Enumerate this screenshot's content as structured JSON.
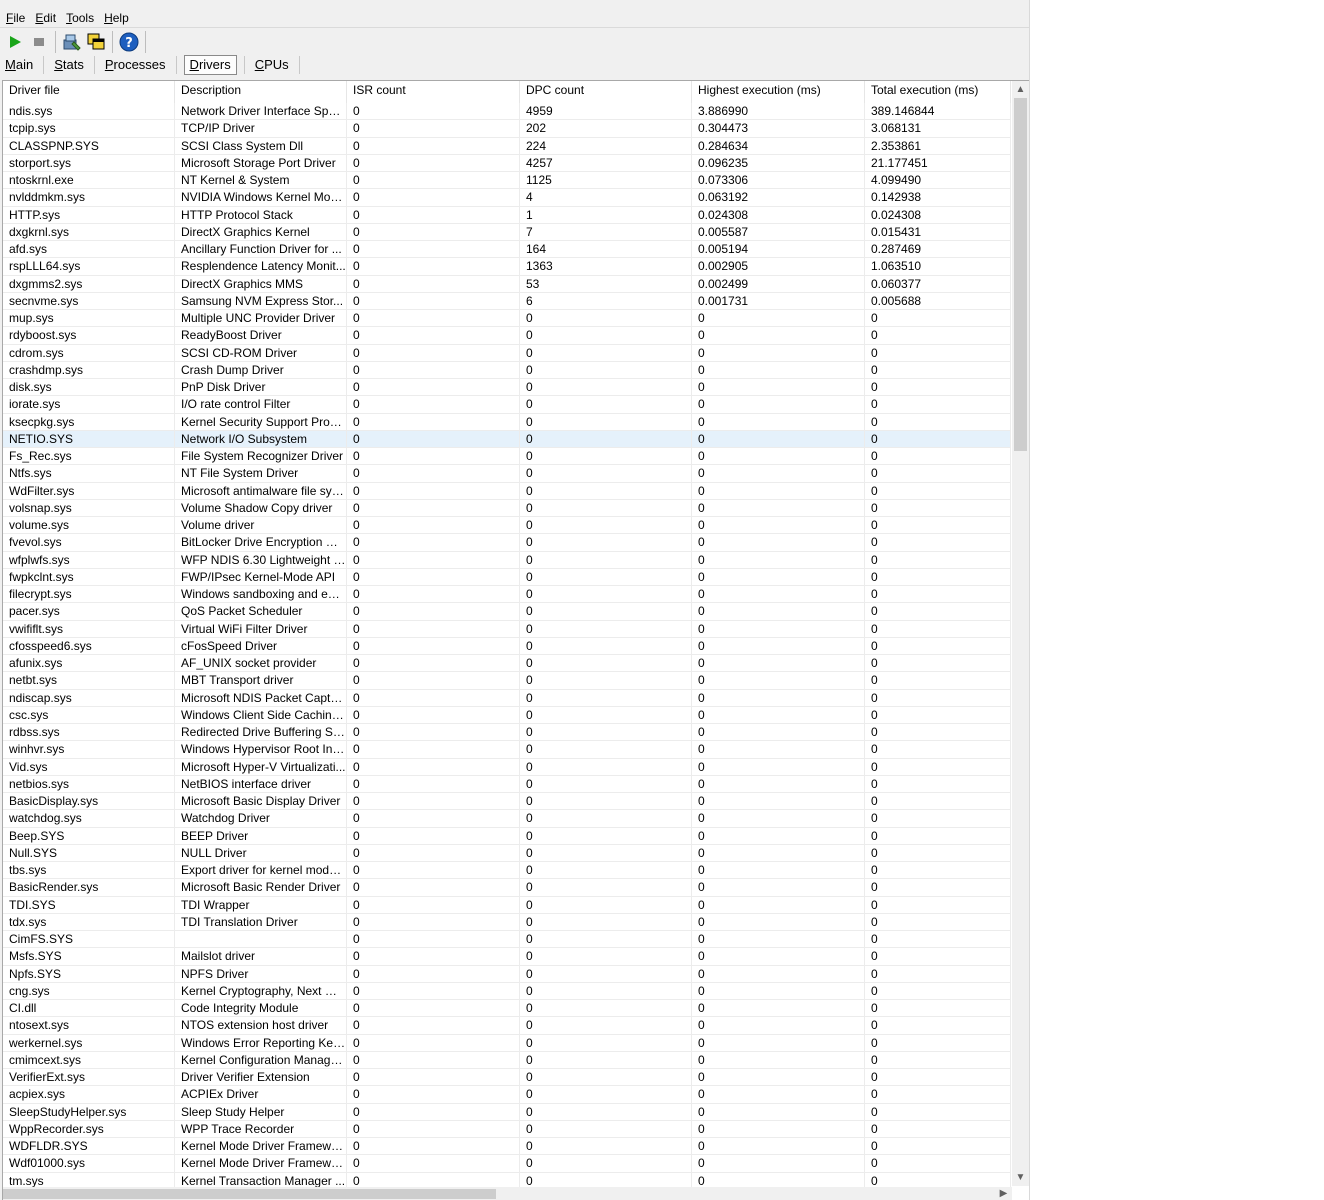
{
  "menu": [
    {
      "ul": "F",
      "rest": "ile"
    },
    {
      "ul": "E",
      "rest": "dit"
    },
    {
      "ul": "T",
      "rest": "ools"
    },
    {
      "ul": "H",
      "rest": "elp"
    }
  ],
  "toolbar": {
    "icons": [
      "play-icon",
      "stop-icon",
      "driver-icon",
      "copy-windows-icon",
      "help-icon"
    ],
    "colors": {
      "play": "#1aa51a",
      "stop": "#8c8c8c",
      "help": "#1e5fbf"
    }
  },
  "tabs": [
    {
      "ul": "M",
      "rest": "ain",
      "active": false
    },
    {
      "ul": "S",
      "rest": "tats",
      "active": false
    },
    {
      "ul": "P",
      "rest": "rocesses",
      "active": false
    },
    {
      "ul": "D",
      "rest": "rivers",
      "active": true
    },
    {
      "ul": "C",
      "rest": "PUs",
      "active": false
    }
  ],
  "table": {
    "columns": [
      "Driver file",
      "Description",
      "ISR count",
      "DPC count",
      "Highest execution (ms)",
      "Total execution (ms)"
    ],
    "selected_row": 19,
    "rows": [
      [
        "ndis.sys",
        "Network Driver Interface Speci...",
        "0",
        "4959",
        "3.886990",
        "389.146844"
      ],
      [
        "tcpip.sys",
        "TCP/IP Driver",
        "0",
        "202",
        "0.304473",
        "3.068131"
      ],
      [
        "CLASSPNP.SYS",
        "SCSI Class System Dll",
        "0",
        "224",
        "0.284634",
        "2.353861"
      ],
      [
        "storport.sys",
        "Microsoft Storage Port Driver",
        "0",
        "4257",
        "0.096235",
        "21.177451"
      ],
      [
        "ntoskrnl.exe",
        "NT Kernel & System",
        "0",
        "1125",
        "0.073306",
        "4.099490"
      ],
      [
        "nvlddmkm.sys",
        "NVIDIA Windows Kernel Mod...",
        "0",
        "4",
        "0.063192",
        "0.142938"
      ],
      [
        "HTTP.sys",
        "HTTP Protocol Stack",
        "0",
        "1",
        "0.024308",
        "0.024308"
      ],
      [
        "dxgkrnl.sys",
        "DirectX Graphics Kernel",
        "0",
        "7",
        "0.005587",
        "0.015431"
      ],
      [
        "afd.sys",
        "Ancillary Function Driver for ...",
        "0",
        "164",
        "0.005194",
        "0.287469"
      ],
      [
        "rspLLL64.sys",
        "Resplendence Latency Monit...",
        "0",
        "1363",
        "0.002905",
        "1.063510"
      ],
      [
        "dxgmms2.sys",
        "DirectX Graphics MMS",
        "0",
        "53",
        "0.002499",
        "0.060377"
      ],
      [
        "secnvme.sys",
        "Samsung NVM Express Stor...",
        "0",
        "6",
        "0.001731",
        "0.005688"
      ],
      [
        "mup.sys",
        "Multiple UNC Provider Driver",
        "0",
        "0",
        "0",
        "0"
      ],
      [
        "rdyboost.sys",
        "ReadyBoost Driver",
        "0",
        "0",
        "0",
        "0"
      ],
      [
        "cdrom.sys",
        "SCSI CD-ROM Driver",
        "0",
        "0",
        "0",
        "0"
      ],
      [
        "crashdmp.sys",
        "Crash Dump Driver",
        "0",
        "0",
        "0",
        "0"
      ],
      [
        "disk.sys",
        "PnP Disk Driver",
        "0",
        "0",
        "0",
        "0"
      ],
      [
        "iorate.sys",
        "I/O rate control Filter",
        "0",
        "0",
        "0",
        "0"
      ],
      [
        "ksecpkg.sys",
        "Kernel Security Support Provi...",
        "0",
        "0",
        "0",
        "0"
      ],
      [
        "NETIO.SYS",
        "Network I/O Subsystem",
        "0",
        "0",
        "0",
        "0"
      ],
      [
        "Fs_Rec.sys",
        "File System Recognizer Driver",
        "0",
        "0",
        "0",
        "0"
      ],
      [
        "Ntfs.sys",
        "NT File System Driver",
        "0",
        "0",
        "0",
        "0"
      ],
      [
        "WdFilter.sys",
        "Microsoft antimalware file sys...",
        "0",
        "0",
        "0",
        "0"
      ],
      [
        "volsnap.sys",
        "Volume Shadow Copy driver",
        "0",
        "0",
        "0",
        "0"
      ],
      [
        "volume.sys",
        "Volume driver",
        "0",
        "0",
        "0",
        "0"
      ],
      [
        "fvevol.sys",
        "BitLocker Drive Encryption Dri...",
        "0",
        "0",
        "0",
        "0"
      ],
      [
        "wfplwfs.sys",
        "WFP NDIS 6.30 Lightweight F...",
        "0",
        "0",
        "0",
        "0"
      ],
      [
        "fwpkclnt.sys",
        "FWP/IPsec Kernel-Mode API",
        "0",
        "0",
        "0",
        "0"
      ],
      [
        "filecrypt.sys",
        "Windows sandboxing and enc...",
        "0",
        "0",
        "0",
        "0"
      ],
      [
        "pacer.sys",
        "QoS Packet Scheduler",
        "0",
        "0",
        "0",
        "0"
      ],
      [
        "vwififlt.sys",
        "Virtual WiFi Filter Driver",
        "0",
        "0",
        "0",
        "0"
      ],
      [
        "cfosspeed6.sys",
        "cFosSpeed Driver",
        "0",
        "0",
        "0",
        "0"
      ],
      [
        "afunix.sys",
        "AF_UNIX socket provider",
        "0",
        "0",
        "0",
        "0"
      ],
      [
        "netbt.sys",
        "MBT Transport driver",
        "0",
        "0",
        "0",
        "0"
      ],
      [
        "ndiscap.sys",
        "Microsoft NDIS Packet Captur...",
        "0",
        "0",
        "0",
        "0"
      ],
      [
        "csc.sys",
        "Windows Client Side Caching...",
        "0",
        "0",
        "0",
        "0"
      ],
      [
        "rdbss.sys",
        "Redirected Drive Buffering Su...",
        "0",
        "0",
        "0",
        "0"
      ],
      [
        "winhvr.sys",
        "Windows Hypervisor Root Inte...",
        "0",
        "0",
        "0",
        "0"
      ],
      [
        "Vid.sys",
        "Microsoft Hyper-V Virtualizati...",
        "0",
        "0",
        "0",
        "0"
      ],
      [
        "netbios.sys",
        "NetBIOS interface driver",
        "0",
        "0",
        "0",
        "0"
      ],
      [
        "BasicDisplay.sys",
        "Microsoft Basic Display Driver",
        "0",
        "0",
        "0",
        "0"
      ],
      [
        "watchdog.sys",
        "Watchdog Driver",
        "0",
        "0",
        "0",
        "0"
      ],
      [
        "Beep.SYS",
        "BEEP Driver",
        "0",
        "0",
        "0",
        "0"
      ],
      [
        "Null.SYS",
        "NULL Driver",
        "0",
        "0",
        "0",
        "0"
      ],
      [
        "tbs.sys",
        "Export driver for kernel mode ...",
        "0",
        "0",
        "0",
        "0"
      ],
      [
        "BasicRender.sys",
        "Microsoft Basic Render Driver",
        "0",
        "0",
        "0",
        "0"
      ],
      [
        "TDI.SYS",
        "TDI Wrapper",
        "0",
        "0",
        "0",
        "0"
      ],
      [
        "tdx.sys",
        "TDI Translation Driver",
        "0",
        "0",
        "0",
        "0"
      ],
      [
        "CimFS.SYS",
        "",
        "0",
        "0",
        "0",
        "0"
      ],
      [
        "Msfs.SYS",
        "Mailslot driver",
        "0",
        "0",
        "0",
        "0"
      ],
      [
        "Npfs.SYS",
        "NPFS Driver",
        "0",
        "0",
        "0",
        "0"
      ],
      [
        "cng.sys",
        "Kernel Cryptography, Next Ge...",
        "0",
        "0",
        "0",
        "0"
      ],
      [
        "CI.dll",
        "Code Integrity Module",
        "0",
        "0",
        "0",
        "0"
      ],
      [
        "ntosext.sys",
        "NTOS extension host driver",
        "0",
        "0",
        "0",
        "0"
      ],
      [
        "werkernel.sys",
        "Windows Error Reporting Ker...",
        "0",
        "0",
        "0",
        "0"
      ],
      [
        "cmimcext.sys",
        "Kernel Configuration Manager ...",
        "0",
        "0",
        "0",
        "0"
      ],
      [
        "VerifierExt.sys",
        "Driver Verifier Extension",
        "0",
        "0",
        "0",
        "0"
      ],
      [
        "acpiex.sys",
        "ACPIEx Driver",
        "0",
        "0",
        "0",
        "0"
      ],
      [
        "SleepStudyHelper.sys",
        "Sleep Study Helper",
        "0",
        "0",
        "0",
        "0"
      ],
      [
        "WppRecorder.sys",
        "WPP Trace Recorder",
        "0",
        "0",
        "0",
        "0"
      ],
      [
        "WDFLDR.SYS",
        "Kernel Mode Driver Framewor...",
        "0",
        "0",
        "0",
        "0"
      ],
      [
        "Wdf01000.sys",
        "Kernel Mode Driver Framewor...",
        "0",
        "0",
        "0",
        "0"
      ],
      [
        "tm.sys",
        "Kernel Transaction Manager ...",
        "0",
        "0",
        "0",
        "0"
      ]
    ]
  }
}
